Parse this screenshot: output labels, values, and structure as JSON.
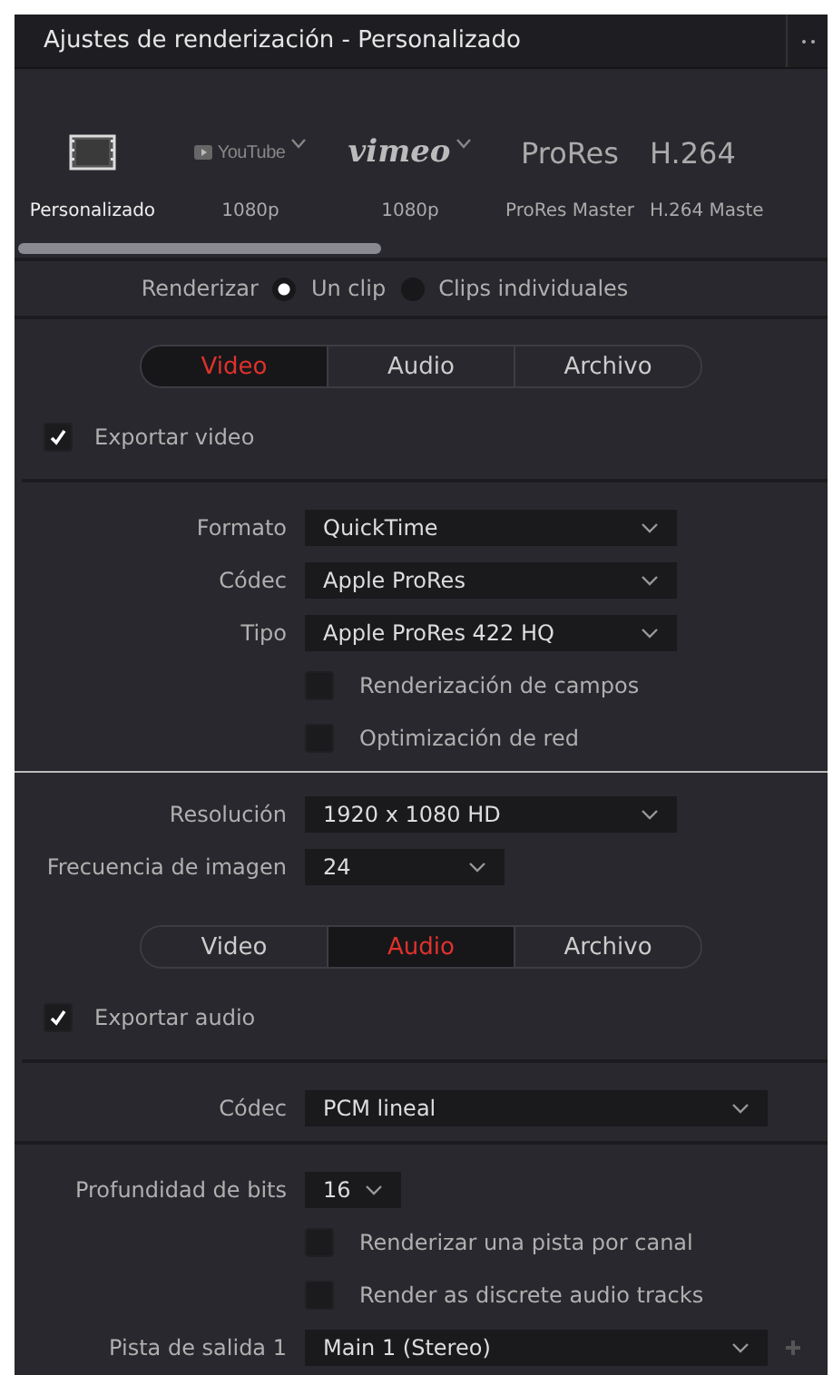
{
  "window": {
    "title": "Ajustes de renderización - Personalizado"
  },
  "presets": [
    {
      "kind": "film",
      "label": "Personalizado",
      "selected": true
    },
    {
      "kind": "youtube",
      "name": "YouTube",
      "label": "1080p",
      "selected": false
    },
    {
      "kind": "vimeo",
      "name": "vimeo",
      "label": "1080p",
      "selected": false
    },
    {
      "kind": "text",
      "name": "ProRes",
      "label": "ProRes Master",
      "selected": false
    },
    {
      "kind": "text",
      "name": "H.264",
      "label": "H.264 Maste",
      "selected": false
    }
  ],
  "render": {
    "label": "Renderizar",
    "options": [
      {
        "label": "Un clip",
        "selected": true
      },
      {
        "label": "Clips individuales",
        "selected": false
      }
    ]
  },
  "sections": [
    {
      "tabs": [
        {
          "label": "Video",
          "selected": true
        },
        {
          "label": "Audio",
          "selected": false
        },
        {
          "label": "Archivo",
          "selected": false
        }
      ],
      "export": {
        "label": "Exportar video",
        "checked": true
      },
      "groups": [
        [
          {
            "kind": "select",
            "label": "Formato",
            "value": "QuickTime"
          },
          {
            "kind": "select",
            "label": "Códec",
            "value": "Apple ProRes"
          },
          {
            "kind": "select",
            "label": "Tipo",
            "value": "Apple ProRes 422 HQ"
          },
          {
            "kind": "checkbox",
            "label": "Renderización de campos",
            "checked": false
          },
          {
            "kind": "checkbox",
            "label": "Optimización de red",
            "checked": false
          }
        ]
      ]
    },
    {
      "groups": [
        [
          {
            "kind": "select",
            "label": "Resolución",
            "value": "1920 x 1080 HD"
          },
          {
            "kind": "select-short",
            "label": "Frecuencia de imagen",
            "value": "24"
          }
        ]
      ]
    },
    {
      "tabs": [
        {
          "label": "Video",
          "selected": false
        },
        {
          "label": "Audio",
          "selected": true
        },
        {
          "label": "Archivo",
          "selected": false
        }
      ],
      "export": {
        "label": "Exportar audio",
        "checked": true
      },
      "groups": [
        [
          {
            "kind": "select-wide",
            "label": "Códec",
            "value": "PCM lineal"
          }
        ],
        [
          {
            "kind": "select-tiny",
            "label": "Profundidad de bits",
            "value": "16"
          },
          {
            "kind": "checkbox",
            "label": "Renderizar una pista por canal",
            "checked": false
          },
          {
            "kind": "checkbox",
            "label": "Render as discrete audio tracks",
            "checked": false
          },
          {
            "kind": "select-add",
            "label": "Pista de salida 1",
            "value": "Main 1 (Stereo)"
          }
        ]
      ]
    }
  ]
}
